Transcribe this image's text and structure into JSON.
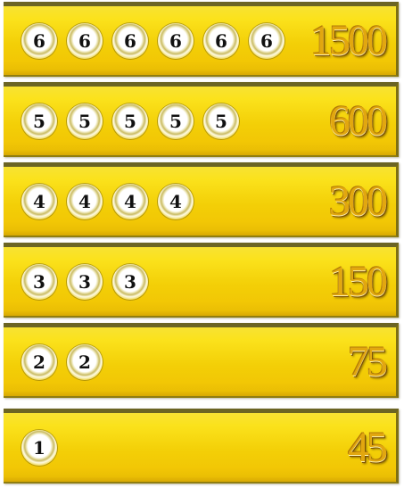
{
  "paytable": {
    "rows": [
      {
        "symbol": "6",
        "count": 6,
        "payout": "1500"
      },
      {
        "symbol": "5",
        "count": 5,
        "payout": "600"
      },
      {
        "symbol": "4",
        "count": 4,
        "payout": "300"
      },
      {
        "symbol": "3",
        "count": 3,
        "payout": "150"
      },
      {
        "symbol": "2",
        "count": 2,
        "payout": "75"
      },
      {
        "symbol": "1",
        "count": 1,
        "payout": "45"
      }
    ]
  }
}
